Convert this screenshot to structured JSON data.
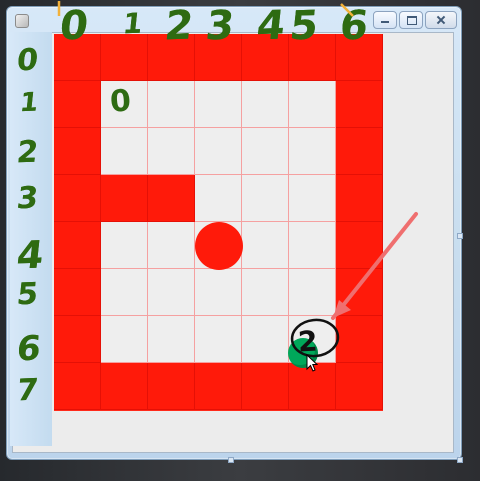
{
  "window": {
    "controls": {
      "minimize_icon": "minimize-icon",
      "maximize_icon": "maximize-icon",
      "close_icon": "close-icon"
    }
  },
  "board": {
    "cols": 7,
    "rows": 8,
    "cell_colors": {
      "wall": "#ff1a0a",
      "open": "#eeeeee",
      "grid_open": "#f5a0a0"
    },
    "cells": [
      [
        "wall",
        "wall",
        "wall",
        "wall",
        "wall",
        "wall",
        "wall"
      ],
      [
        "wall",
        "open",
        "open",
        "open",
        "open",
        "open",
        "wall"
      ],
      [
        "wall",
        "open",
        "open",
        "open",
        "open",
        "open",
        "wall"
      ],
      [
        "wall",
        "wall",
        "wall",
        "open",
        "open",
        "open",
        "wall"
      ],
      [
        "wall",
        "open",
        "open",
        "open",
        "open",
        "open",
        "wall"
      ],
      [
        "wall",
        "open",
        "open",
        "open",
        "open",
        "open",
        "wall"
      ],
      [
        "wall",
        "open",
        "open",
        "open",
        "open",
        "open",
        "wall"
      ],
      [
        "wall",
        "wall",
        "wall",
        "wall",
        "wall",
        "wall",
        "wall"
      ]
    ],
    "red_ball_color": "#ff1a0a",
    "green_ball_color": "#00a85a"
  },
  "annotations": {
    "top_numbers": [
      "0",
      "1",
      "2",
      "3",
      "4",
      "5",
      "6"
    ],
    "side_numbers": [
      "0",
      "1",
      "2",
      "3",
      "4",
      "5",
      "6",
      "7"
    ],
    "cell_note": "0",
    "pen_note": "2",
    "annotation_color": "#2e6b12",
    "arrow_color": "#ef6f6f",
    "circle_color": "#111111",
    "top_tick_color": "#f2b13a"
  }
}
